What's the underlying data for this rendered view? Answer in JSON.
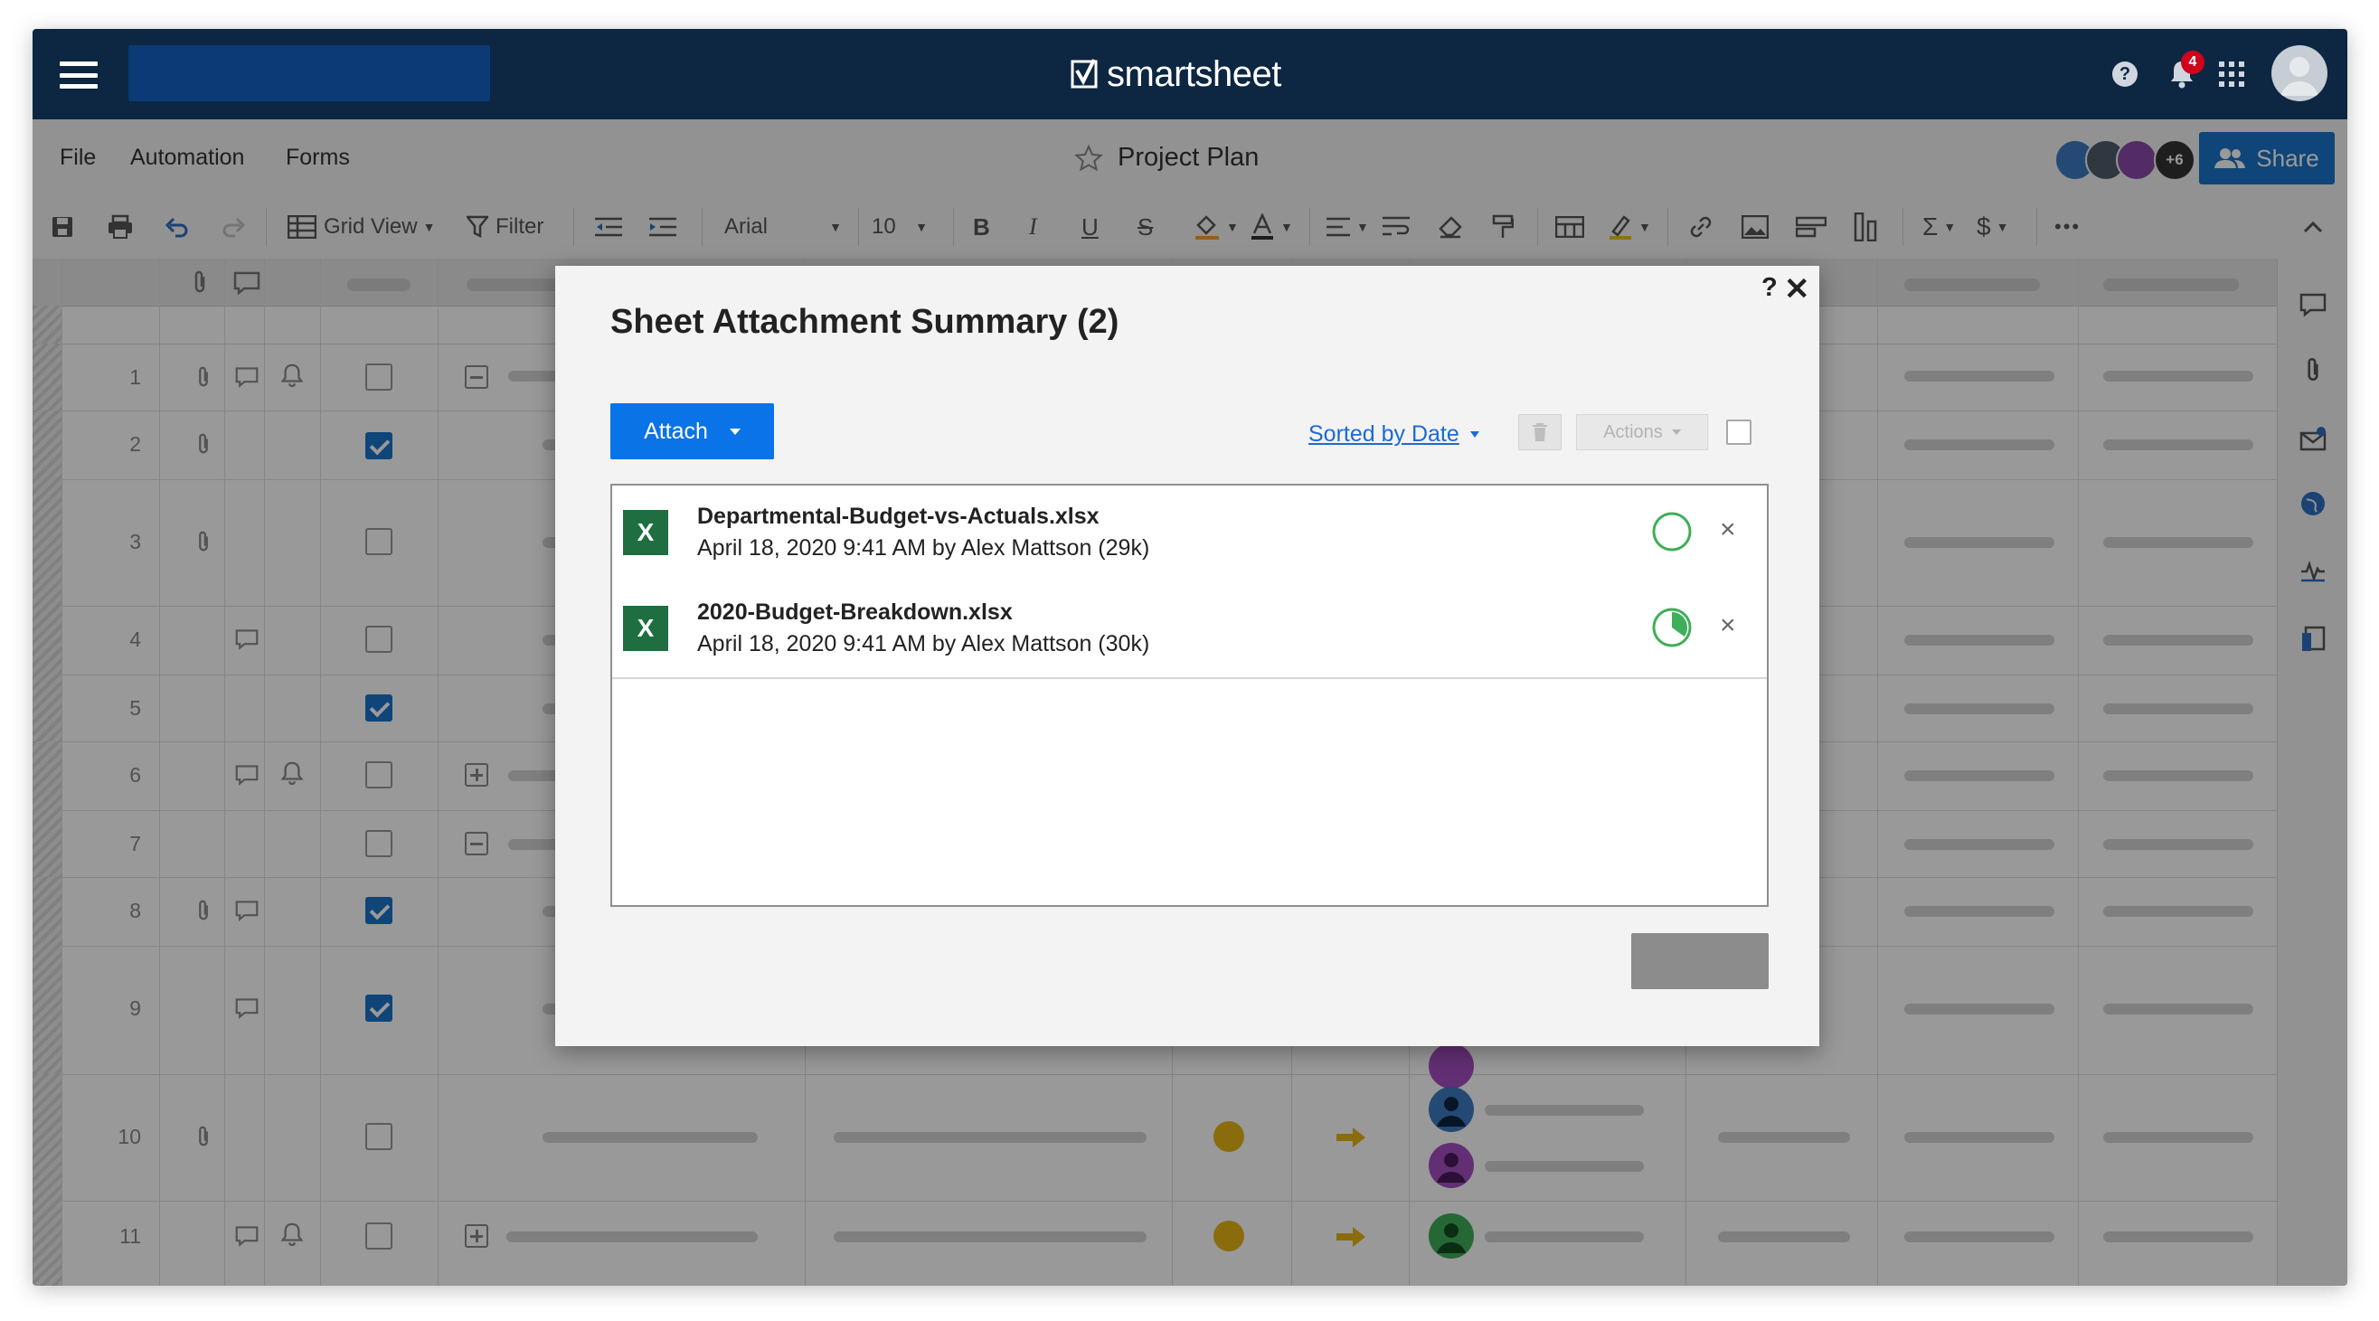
{
  "brand": {
    "name": "smartsheet"
  },
  "header": {
    "notification_count": "4",
    "help_label": "?"
  },
  "menubar": {
    "file": "File",
    "automation": "Automation",
    "forms": "Forms",
    "sheet_title": "Project Plan",
    "collaborators_more": "+6",
    "share_label": "Share"
  },
  "toolbar": {
    "view_label": "Grid View",
    "filter_label": "Filter",
    "font_family": "Arial",
    "font_size": "10",
    "currency": "$",
    "sum": "Σ",
    "more": "•••"
  },
  "grid": {
    "row_numbers": [
      "1",
      "2",
      "3",
      "4",
      "5",
      "6",
      "7",
      "8",
      "9",
      "10",
      "11"
    ]
  },
  "modal": {
    "title": "Sheet Attachment Summary (2)",
    "help": "?",
    "close": "✕",
    "attach_label": "Attach",
    "sort_label": "Sorted by Date",
    "actions_label": "Actions",
    "files": [
      {
        "name": "Departmental-Budget-vs-Actuals.xlsx",
        "meta": "April 18, 2020 9:41 AM by Alex Mattson (29k)",
        "icon": "excel-icon",
        "progress": 0
      },
      {
        "name": "2020-Budget-Breakdown.xlsx",
        "meta": "April 18, 2020 9:41 AM by Alex Mattson (30k)",
        "icon": "excel-icon",
        "progress": 0.35
      }
    ],
    "excel_glyph": "X"
  },
  "colors": {
    "topbar": "#0d2641",
    "accent": "#0a73e8",
    "excel": "#1e6e42",
    "progress": "#3fae5a",
    "status": "#e7b416"
  }
}
